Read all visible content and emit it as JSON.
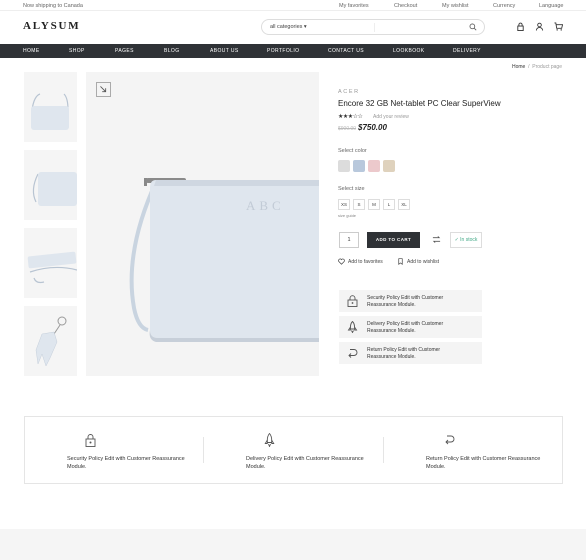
{
  "topbar": {
    "shipping": "Now shipping to Canada",
    "links": [
      "My favorites",
      "Checkout",
      "My wishlist",
      "Currency",
      "Language"
    ]
  },
  "header": {
    "logo": "ALYSUM",
    "search_category": "all categories ▾",
    "icons": [
      "lock-icon",
      "user-icon",
      "cart-icon"
    ]
  },
  "nav": {
    "items": [
      "HOME",
      "SHOP",
      "PAGES",
      "BLOG",
      "ABOUT US",
      "PORTFOLIO",
      "CONTACT US",
      "LOOKBOOK",
      "DELIVERY"
    ]
  },
  "breadcrumb": {
    "home": "Home",
    "current": "Product page"
  },
  "product": {
    "brand": "ACER",
    "title": "Encore 32 GB Net-tablet PC Clear SuperView",
    "rating": "★★★☆☆",
    "review_link": "Add your review",
    "old_price": "$900.00",
    "price": "$750.00",
    "color_label": "Select color",
    "colors": [
      "#dcdcdc",
      "#b8c8dc",
      "#ecc9cc",
      "#dfd2bd"
    ],
    "size_label": "Select size",
    "sizes": [
      "XS",
      "S",
      "M",
      "L",
      "XL"
    ],
    "size_guide": "size guide",
    "quantity": "1",
    "add_to_cart": "ADD TO CART",
    "stock": "In stock",
    "favorites": "Add to favorites",
    "wishlist": "Add to wishlist",
    "bag_monogram": "ABC"
  },
  "policies": [
    {
      "icon": "lock-icon",
      "text": "Security Policy Edit with Customer Reassurance Module."
    },
    {
      "icon": "rocket-icon",
      "text": "Delivery Policy Edit with Customer Reassurance Module."
    },
    {
      "icon": "return-icon",
      "text": "Return Policy Edit with Customer Reassurance Module."
    }
  ],
  "colors": {
    "nav_bg": "#2f3236",
    "in_stock": "#44aa88"
  }
}
